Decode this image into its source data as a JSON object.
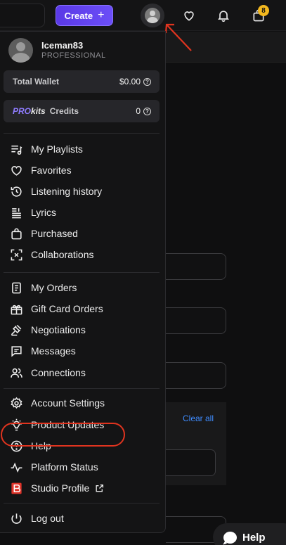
{
  "header": {
    "create_label": "Create",
    "create_plus": "+",
    "cart_count": "8",
    "icons": [
      "avatar",
      "heart-icon",
      "bell-icon",
      "bag-icon"
    ]
  },
  "profile": {
    "username": "Iceman83",
    "role": "PROFESSIONAL"
  },
  "wallet": {
    "total_label": "Total Wallet",
    "total_value": "$0.00",
    "credits_pro": "PRO",
    "credits_kits": "kits",
    "credits_label": "Credits",
    "credits_value": "0"
  },
  "menu": {
    "group1": [
      "My Playlists",
      "Favorites",
      "Listening history",
      "Lyrics",
      "Purchased",
      "Collaborations"
    ],
    "group2": [
      "My Orders",
      "Gift Card Orders",
      "Negotiations",
      "Messages",
      "Connections"
    ],
    "group3": [
      "Account Settings",
      "Product Updates",
      "Help",
      "Platform Status",
      "Studio Profile"
    ],
    "logout": "Log out"
  },
  "background": {
    "clear_all": "Clear all",
    "help_button": "Help"
  },
  "colors": {
    "accent": "#5a39e6",
    "badge": "#f3b81f",
    "highlight": "#e0341f",
    "link": "#3f8cff",
    "studio_brand": "#e0342a"
  }
}
